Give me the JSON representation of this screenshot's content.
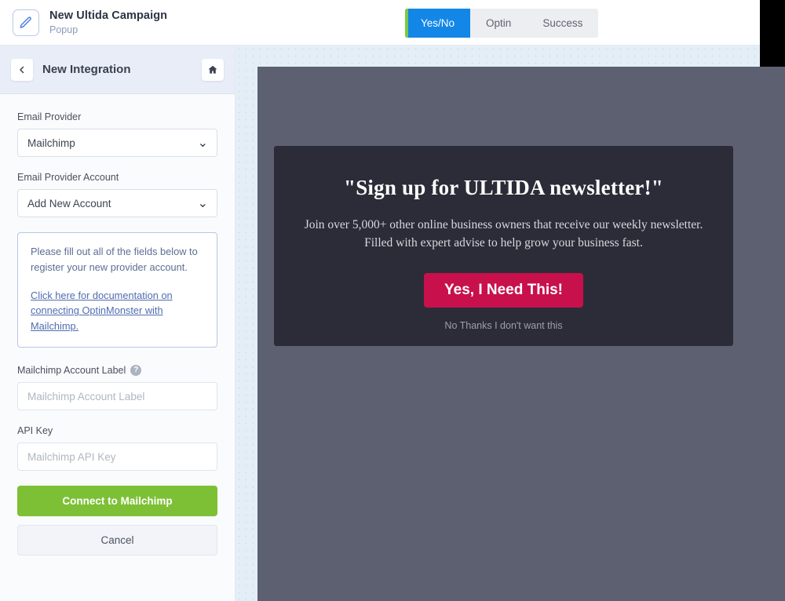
{
  "topbar": {
    "pencil_icon": "pencil-icon",
    "title": "New Ultida Campaign",
    "subtitle": "Popup",
    "tabs": [
      {
        "label": "Yes/No",
        "active": true
      },
      {
        "label": "Optin",
        "active": false
      },
      {
        "label": "Success",
        "active": false
      }
    ],
    "active_tab_bg": "#1287e8",
    "active_tab_accent": "#7ac943"
  },
  "sidebar": {
    "back_icon": "chevron-left-icon",
    "home_icon": "home-icon",
    "title": "New Integration",
    "fields": {
      "email_provider": {
        "label": "Email Provider",
        "value": "Mailchimp",
        "chevron": "chevron-down-icon"
      },
      "email_provider_account": {
        "label": "Email Provider Account",
        "value": "Add New Account",
        "chevron": "chevron-down-icon"
      },
      "account_label": {
        "label": "Mailchimp Account Label",
        "help_icon": "?",
        "value": "",
        "placeholder": "Mailchimp Account Label"
      },
      "api_key": {
        "label": "API Key",
        "value": "",
        "placeholder": "Mailchimp API Key"
      }
    },
    "infobox": {
      "text": "Please fill out all of the fields below to register your new provider account.",
      "link": "Click here for documentation on connecting OptinMonster with Mailchimp."
    },
    "buttons": {
      "connect": "Connect to Mailchimp",
      "cancel": "Cancel",
      "connect_color": "#7dc035"
    }
  },
  "canvas": {
    "popup": {
      "headline": "\"Sign up for ULTIDA newsletter!\"",
      "subtext_line1": "Join over 5,000+ other online business owners that receive our weekly newsletter.",
      "subtext_line2": "Filled with expert advise to help grow your business fast.",
      "cta_label": "Yes, I Need This!",
      "cta_color": "#c8104c",
      "decline_label": "No Thanks I don't want this",
      "background": "#2b2c37"
    },
    "preview_background": "#5c6070"
  }
}
